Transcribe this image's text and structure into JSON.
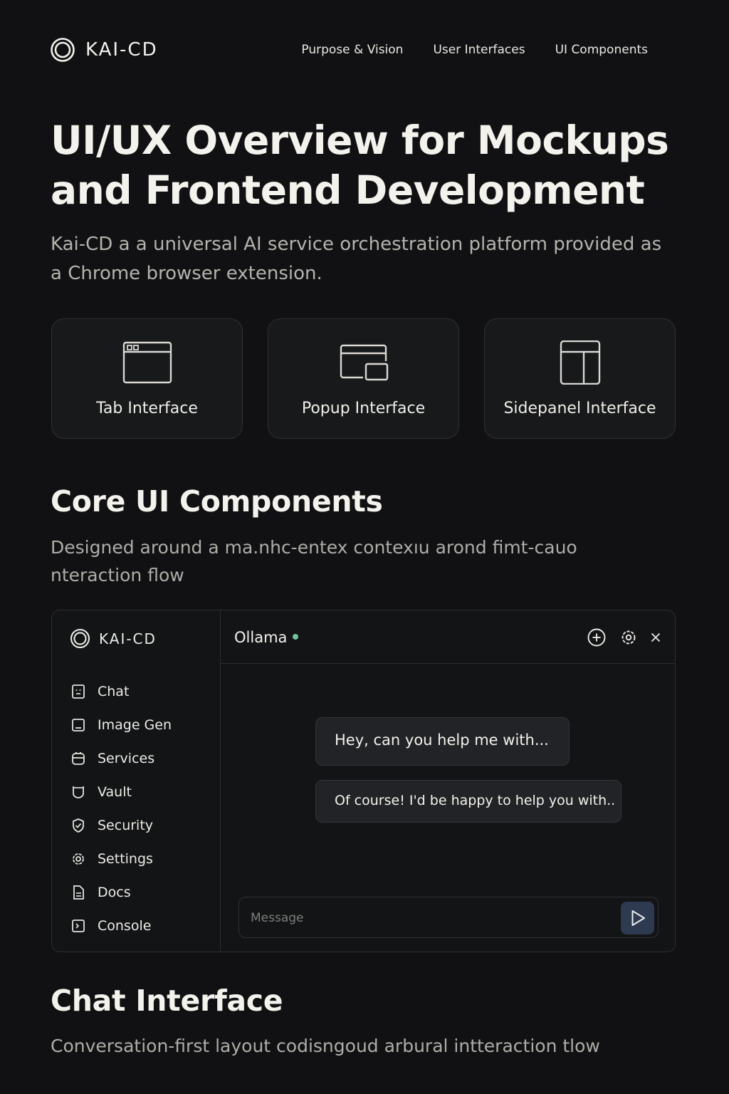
{
  "brand": {
    "name": "KAI-CD"
  },
  "nav": {
    "links": [
      "Purpose & Vision",
      "User Interfaces",
      "UI Components"
    ]
  },
  "hero": {
    "title": "UI/UX Overview for Mockups and Frontend Development",
    "subtitle": "Kai-CD a a universal AI service orchestration platform provided as a Chrome browser extension."
  },
  "cards": [
    {
      "label": "Tab Interface",
      "icon": "tab-window-icon"
    },
    {
      "label": "Popup Interface",
      "icon": "popup-window-icon"
    },
    {
      "label": "Sidepanel Interface",
      "icon": "sidepanel-icon"
    }
  ],
  "core": {
    "title": "Core UI Components",
    "subtitle": "Designed around a ma.nhc-entex contexıu arond fimt-cauo nteraction flow"
  },
  "mockup": {
    "brand": "KAI-CD",
    "sidebar": [
      {
        "label": "Chat",
        "icon": "chat-icon"
      },
      {
        "label": "Image Gen",
        "icon": "image-icon"
      },
      {
        "label": "Services",
        "icon": "services-icon"
      },
      {
        "label": "Vault",
        "icon": "vault-icon"
      },
      {
        "label": "Security",
        "icon": "shield-icon"
      },
      {
        "label": "Settings",
        "icon": "gear-icon"
      },
      {
        "label": "Docs",
        "icon": "document-icon"
      },
      {
        "label": "Console",
        "icon": "console-icon"
      }
    ],
    "model": "Ollama",
    "status_color": "#6fc49a",
    "messages": [
      {
        "role": "user",
        "text": "Hey, can you help me with..."
      },
      {
        "role": "assistant",
        "text": "Of course! I'd be happy to help you with.."
      }
    ],
    "input_placeholder": "Message"
  },
  "chat": {
    "title": "Chat Interface",
    "subtitle": "Conversation-first layout codisngoud arbural intteraction tlow"
  },
  "colors": {
    "background": "#111113",
    "card": "#18191b",
    "accent": "#2e3a4f"
  }
}
